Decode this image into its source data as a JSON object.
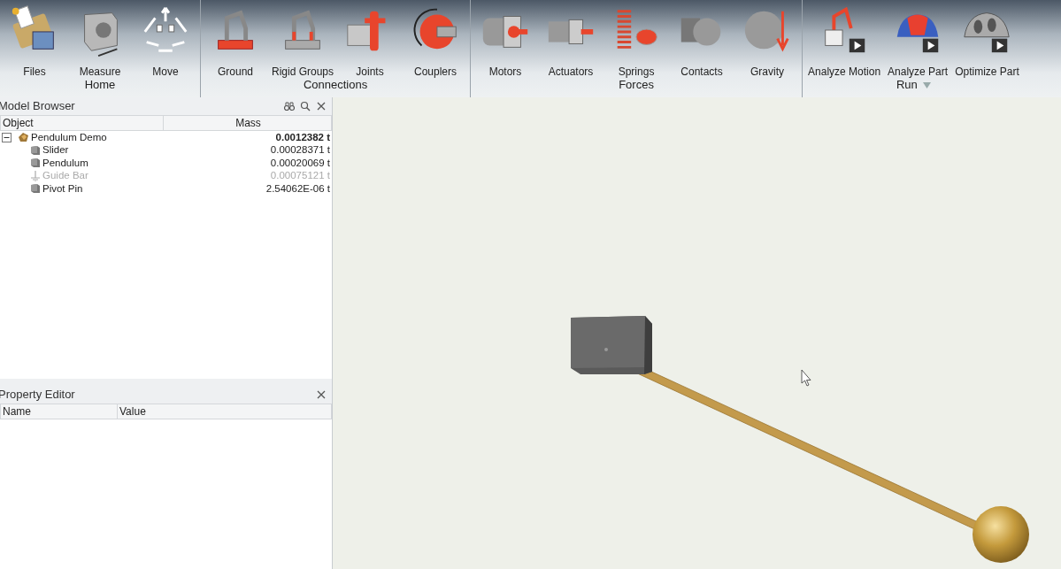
{
  "ribbon": {
    "groups": [
      {
        "label": "Home",
        "menu": false,
        "tools": [
          {
            "label": "Files"
          },
          {
            "label": "Measure"
          },
          {
            "label": "Move"
          }
        ]
      },
      {
        "label": "Connections",
        "menu": false,
        "tools": [
          {
            "label": "Ground"
          },
          {
            "label": "Rigid Groups"
          },
          {
            "label": "Joints"
          },
          {
            "label": "Couplers"
          }
        ]
      },
      {
        "label": "Forces",
        "menu": false,
        "tools": [
          {
            "label": "Motors"
          },
          {
            "label": "Actuators"
          },
          {
            "label": "Springs"
          },
          {
            "label": "Contacts"
          },
          {
            "label": "Gravity"
          }
        ]
      },
      {
        "label": "Run",
        "menu": true,
        "tools": [
          {
            "label": "Analyze Motion"
          },
          {
            "label": "Analyze Part"
          },
          {
            "label": "Optimize Part"
          }
        ]
      }
    ]
  },
  "model_browser": {
    "title": "Model Browser",
    "columns": [
      "Object",
      "Mass"
    ],
    "tree": [
      {
        "kind": "assembly",
        "name": "Pendulum Demo",
        "mass": "0.0012382 t",
        "expanded": true,
        "disabled": false,
        "children": [
          {
            "kind": "part",
            "name": "Slider",
            "mass": "0.00028371 t",
            "disabled": false
          },
          {
            "kind": "part",
            "name": "Pendulum",
            "mass": "0.00020069 t",
            "disabled": false
          },
          {
            "kind": "ground",
            "name": "Guide Bar",
            "mass": "0.00075121 t",
            "disabled": true
          },
          {
            "kind": "part",
            "name": "Pivot Pin",
            "mass": "2.54062E-06 t",
            "disabled": false
          }
        ]
      }
    ]
  },
  "property_editor": {
    "title": "Property Editor",
    "columns": [
      "Name",
      "Value"
    ]
  }
}
